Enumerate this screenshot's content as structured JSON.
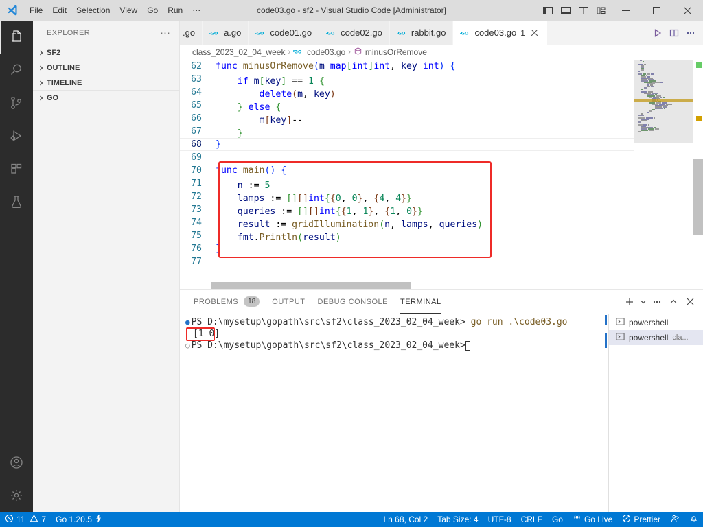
{
  "window": {
    "title": "code03.go - sf2 - Visual Studio Code [Administrator]",
    "menus": [
      "File",
      "Edit",
      "Selection",
      "View",
      "Go",
      "Run",
      "⋯"
    ],
    "layout_buttons": [
      "toggle-primary-sidebar",
      "toggle-panel",
      "toggle-secondary-sidebar",
      "customize-layout"
    ],
    "controls": {
      "minimize": "—",
      "maximize": "□",
      "close": "✕"
    }
  },
  "activitybar": {
    "items": [
      {
        "name": "explorer",
        "active": true
      },
      {
        "name": "search",
        "active": false
      },
      {
        "name": "source-control",
        "active": false
      },
      {
        "name": "run-and-debug",
        "active": false
      },
      {
        "name": "extensions",
        "active": false
      },
      {
        "name": "testing",
        "active": false
      }
    ],
    "bottom": [
      {
        "name": "accounts"
      },
      {
        "name": "manage-settings"
      }
    ]
  },
  "sidebar": {
    "title": "EXPLORER",
    "more_actions": "⋯",
    "sections": [
      {
        "label": "SF2",
        "expanded": false
      },
      {
        "label": "OUTLINE",
        "expanded": false
      },
      {
        "label": "TIMELINE",
        "expanded": false
      },
      {
        "label": "GO",
        "expanded": false
      }
    ]
  },
  "tabs": [
    {
      "label": ".go",
      "active": false,
      "dirty": false,
      "badge": "",
      "truncated": true
    },
    {
      "label": "a.go",
      "active": false,
      "dirty": false,
      "badge": ""
    },
    {
      "label": "code01.go",
      "active": false,
      "dirty": false,
      "badge": ""
    },
    {
      "label": "code02.go",
      "active": false,
      "dirty": false,
      "badge": ""
    },
    {
      "label": "rabbit.go",
      "active": false,
      "dirty": false,
      "badge": ""
    },
    {
      "label": "code03.go",
      "active": true,
      "dirty": false,
      "badge": "1"
    }
  ],
  "tab_actions": [
    "run-or-debug",
    "split-editor-right",
    "more-actions"
  ],
  "breadcrumbs": [
    {
      "label": "class_2023_02_04_week",
      "icon": ""
    },
    {
      "label": "code03.go",
      "icon": "go-file-icon"
    },
    {
      "label": "minusOrRemove",
      "icon": "symbol-method-icon"
    }
  ],
  "editor": {
    "first_line": 62,
    "highlight_box": {
      "from_line": 70,
      "to_line": 76
    },
    "lines": [
      {
        "n": 62,
        "tokens": [
          {
            "t": "func ",
            "c": "kw"
          },
          {
            "t": "minusOrRemove",
            "c": "fn"
          },
          {
            "t": "(",
            "c": "b0"
          },
          {
            "t": "m ",
            "c": "id"
          },
          {
            "t": "map",
            "c": "kw"
          },
          {
            "t": "[",
            "c": "b1"
          },
          {
            "t": "int",
            "c": "kw"
          },
          {
            "t": "]",
            "c": "b1"
          },
          {
            "t": "int",
            "c": "kw"
          },
          {
            "t": ", ",
            "c": "pl"
          },
          {
            "t": "key ",
            "c": "id"
          },
          {
            "t": "int",
            "c": "kw"
          },
          {
            "t": ")",
            "c": "b0"
          },
          {
            "t": " ",
            "c": "pl"
          },
          {
            "t": "{",
            "c": "b0"
          }
        ]
      },
      {
        "n": 63,
        "indent": 1,
        "tokens": [
          {
            "t": "if ",
            "c": "kw"
          },
          {
            "t": "m",
            "c": "id"
          },
          {
            "t": "[",
            "c": "b1"
          },
          {
            "t": "key",
            "c": "id"
          },
          {
            "t": "]",
            "c": "b1"
          },
          {
            "t": " == ",
            "c": "pl"
          },
          {
            "t": "1",
            "c": "num"
          },
          {
            "t": " ",
            "c": "pl"
          },
          {
            "t": "{",
            "c": "b1"
          }
        ]
      },
      {
        "n": 64,
        "indent": 2,
        "tokens": [
          {
            "t": "delete",
            "c": "kw"
          },
          {
            "t": "(",
            "c": "b2"
          },
          {
            "t": "m",
            "c": "id"
          },
          {
            "t": ", ",
            "c": "pl"
          },
          {
            "t": "key",
            "c": "id"
          },
          {
            "t": ")",
            "c": "b2"
          }
        ]
      },
      {
        "n": 65,
        "indent": 1,
        "tokens": [
          {
            "t": "}",
            "c": "b1"
          },
          {
            "t": " ",
            "c": "pl"
          },
          {
            "t": "else",
            "c": "kw"
          },
          {
            "t": " ",
            "c": "pl"
          },
          {
            "t": "{",
            "c": "b1"
          }
        ]
      },
      {
        "n": 66,
        "indent": 2,
        "tokens": [
          {
            "t": "m",
            "c": "id"
          },
          {
            "t": "[",
            "c": "b2"
          },
          {
            "t": "key",
            "c": "id"
          },
          {
            "t": "]",
            "c": "b2"
          },
          {
            "t": "--",
            "c": "pl"
          }
        ]
      },
      {
        "n": 67,
        "indent": 1,
        "tokens": [
          {
            "t": "}",
            "c": "b1"
          }
        ]
      },
      {
        "n": 68,
        "indent": 0,
        "current": true,
        "tokens": [
          {
            "t": "}",
            "c": "b0"
          }
        ]
      },
      {
        "n": 69,
        "indent": 0,
        "tokens": []
      },
      {
        "n": 70,
        "indent": 0,
        "tokens": [
          {
            "t": "func ",
            "c": "kw"
          },
          {
            "t": "main",
            "c": "fn"
          },
          {
            "t": "(",
            "c": "b0"
          },
          {
            "t": ")",
            "c": "b0"
          },
          {
            "t": " ",
            "c": "pl"
          },
          {
            "t": "{",
            "c": "b0"
          }
        ]
      },
      {
        "n": 71,
        "indent": 1,
        "tokens": [
          {
            "t": "n ",
            "c": "id"
          },
          {
            "t": ":= ",
            "c": "pl"
          },
          {
            "t": "5",
            "c": "num"
          }
        ]
      },
      {
        "n": 72,
        "indent": 1,
        "tokens": [
          {
            "t": "lamps ",
            "c": "id"
          },
          {
            "t": ":= ",
            "c": "pl"
          },
          {
            "t": "[",
            "c": "b1"
          },
          {
            "t": "]",
            "c": "b1"
          },
          {
            "t": "[",
            "c": "b2"
          },
          {
            "t": "]",
            "c": "b2"
          },
          {
            "t": "int",
            "c": "kw"
          },
          {
            "t": "{",
            "c": "b1"
          },
          {
            "t": "{",
            "c": "b2"
          },
          {
            "t": "0",
            "c": "num"
          },
          {
            "t": ", ",
            "c": "pl"
          },
          {
            "t": "0",
            "c": "num"
          },
          {
            "t": "}",
            "c": "b2"
          },
          {
            "t": ", ",
            "c": "pl"
          },
          {
            "t": "{",
            "c": "b2"
          },
          {
            "t": "4",
            "c": "num"
          },
          {
            "t": ", ",
            "c": "pl"
          },
          {
            "t": "4",
            "c": "num"
          },
          {
            "t": "}",
            "c": "b2"
          },
          {
            "t": "}",
            "c": "b1"
          }
        ]
      },
      {
        "n": 73,
        "indent": 1,
        "tokens": [
          {
            "t": "queries ",
            "c": "id"
          },
          {
            "t": ":= ",
            "c": "pl"
          },
          {
            "t": "[",
            "c": "b1"
          },
          {
            "t": "]",
            "c": "b1"
          },
          {
            "t": "[",
            "c": "b2"
          },
          {
            "t": "]",
            "c": "b2"
          },
          {
            "t": "int",
            "c": "kw"
          },
          {
            "t": "{",
            "c": "b1"
          },
          {
            "t": "{",
            "c": "b2"
          },
          {
            "t": "1",
            "c": "num"
          },
          {
            "t": ", ",
            "c": "pl"
          },
          {
            "t": "1",
            "c": "num"
          },
          {
            "t": "}",
            "c": "b2"
          },
          {
            "t": ", ",
            "c": "pl"
          },
          {
            "t": "{",
            "c": "b2"
          },
          {
            "t": "1",
            "c": "num"
          },
          {
            "t": ", ",
            "c": "pl"
          },
          {
            "t": "0",
            "c": "num"
          },
          {
            "t": "}",
            "c": "b2"
          },
          {
            "t": "}",
            "c": "b1"
          }
        ]
      },
      {
        "n": 74,
        "indent": 1,
        "tokens": [
          {
            "t": "result ",
            "c": "id"
          },
          {
            "t": ":= ",
            "c": "pl"
          },
          {
            "t": "gridIllumination",
            "c": "fn"
          },
          {
            "t": "(",
            "c": "b1"
          },
          {
            "t": "n",
            "c": "id"
          },
          {
            "t": ", ",
            "c": "pl"
          },
          {
            "t": "lamps",
            "c": "id"
          },
          {
            "t": ", ",
            "c": "pl"
          },
          {
            "t": "queries",
            "c": "id"
          },
          {
            "t": ")",
            "c": "b1"
          }
        ]
      },
      {
        "n": 75,
        "indent": 1,
        "tokens": [
          {
            "t": "fmt",
            "c": "id"
          },
          {
            "t": ".",
            "c": "pl"
          },
          {
            "t": "Println",
            "c": "fn"
          },
          {
            "t": "(",
            "c": "b1"
          },
          {
            "t": "result",
            "c": "id"
          },
          {
            "t": ")",
            "c": "b1"
          }
        ]
      },
      {
        "n": 76,
        "indent": 0,
        "tokens": [
          {
            "t": "}",
            "c": "b0"
          }
        ]
      },
      {
        "n": 77,
        "indent": 0,
        "tokens": []
      }
    ]
  },
  "panel": {
    "tabs": [
      {
        "label": "PROBLEMS",
        "count": "18",
        "active": false
      },
      {
        "label": "OUTPUT",
        "count": "",
        "active": false
      },
      {
        "label": "DEBUG CONSOLE",
        "count": "",
        "active": false
      },
      {
        "label": "TERMINAL",
        "count": "",
        "active": true
      }
    ],
    "actions": [
      "new-terminal",
      "split-dropdown",
      "views-and-more",
      "maximize-panel",
      "close-panel"
    ],
    "terminal": {
      "lines": [
        {
          "marker": "filled",
          "prompt": "PS D:\\mysetup\\gopath\\src\\sf2\\class_2023_02_04_week>",
          "command": " go run .\\code03.go"
        },
        {
          "marker": "",
          "output": "[1 0]",
          "highlighted": true
        },
        {
          "marker": "hollow",
          "prompt": "PS D:\\mysetup\\gopath\\src\\sf2\\class_2023_02_04_week>",
          "command": "",
          "caret": true
        }
      ],
      "tabs": [
        {
          "label": "powershell",
          "sub": "",
          "selected": false
        },
        {
          "label": "powershell",
          "sub": "cla...",
          "selected": true
        }
      ]
    }
  },
  "statusbar": {
    "left": [
      {
        "name": "problems",
        "icon": "error-icon",
        "errors": "11",
        "warnings": "7"
      },
      {
        "name": "go-version",
        "label": "Go 1.20.5",
        "icon": "bolt-icon"
      }
    ],
    "right": [
      {
        "name": "cursor-position",
        "label": "Ln 68, Col 2"
      },
      {
        "name": "tab-size",
        "label": "Tab Size: 4"
      },
      {
        "name": "encoding",
        "label": "UTF-8"
      },
      {
        "name": "eol",
        "label": "CRLF"
      },
      {
        "name": "language-mode",
        "label": "Go"
      },
      {
        "name": "go-live",
        "label": "Go Live",
        "icon": "broadcast-icon"
      },
      {
        "name": "prettier",
        "label": "Prettier",
        "icon": "prettier-icon"
      },
      {
        "name": "remote",
        "label": "",
        "icon": "feedback-icon"
      },
      {
        "name": "notifications",
        "label": "",
        "icon": "bell-icon"
      }
    ]
  },
  "colors": {
    "accent": "#0078d4",
    "highlight_red": "#ee2b28",
    "titlebar_bg": "#dddddd",
    "activitybar_bg": "#2c2c2c",
    "sidebar_bg": "#f3f3f3",
    "editor_bg": "#ffffff",
    "linenumber": "#237893"
  }
}
